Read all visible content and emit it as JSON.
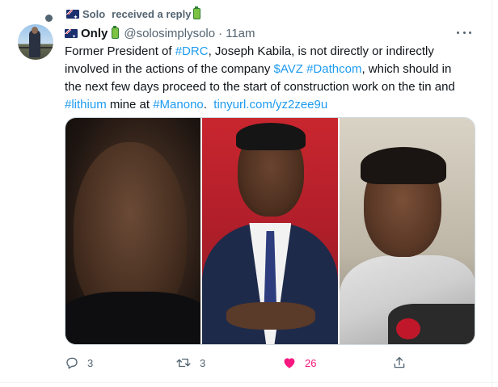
{
  "context": {
    "name": "Solo",
    "suffix": "received a reply",
    "icons": [
      "australia-flag-icon",
      "battery-icon"
    ]
  },
  "tweet": {
    "display_name": "Only",
    "handle": "@solosimplysolo",
    "separator": "·",
    "time": "11am",
    "text_parts": {
      "l1_a": "Former President of ",
      "l1_link": "#DRC",
      "l1_b": ", Joseph Kabila, is not directly or indirectly",
      "l2_a": "involved in the actions of the company ",
      "l2_link1": "$AVZ",
      "l2_space": " ",
      "l2_link2": "#Dathcom",
      "l2_b": ", which should in",
      "l3": "the next few days proceed to the start of construction work on the tin and",
      "l4_link1": "#lithium",
      "l4_a": " mine at ",
      "l4_link2": "#Manono",
      "l4_b": ".  ",
      "l4_link3": "tinyurl.com/yz2zee9u"
    },
    "link_color": "#1d9bf0"
  },
  "actions": {
    "reply_count": "3",
    "retweet_count": "3",
    "like_count": "26",
    "like_color": "#f91880",
    "icons": [
      "reply-icon",
      "retweet-icon",
      "like-icon",
      "share-icon"
    ]
  }
}
